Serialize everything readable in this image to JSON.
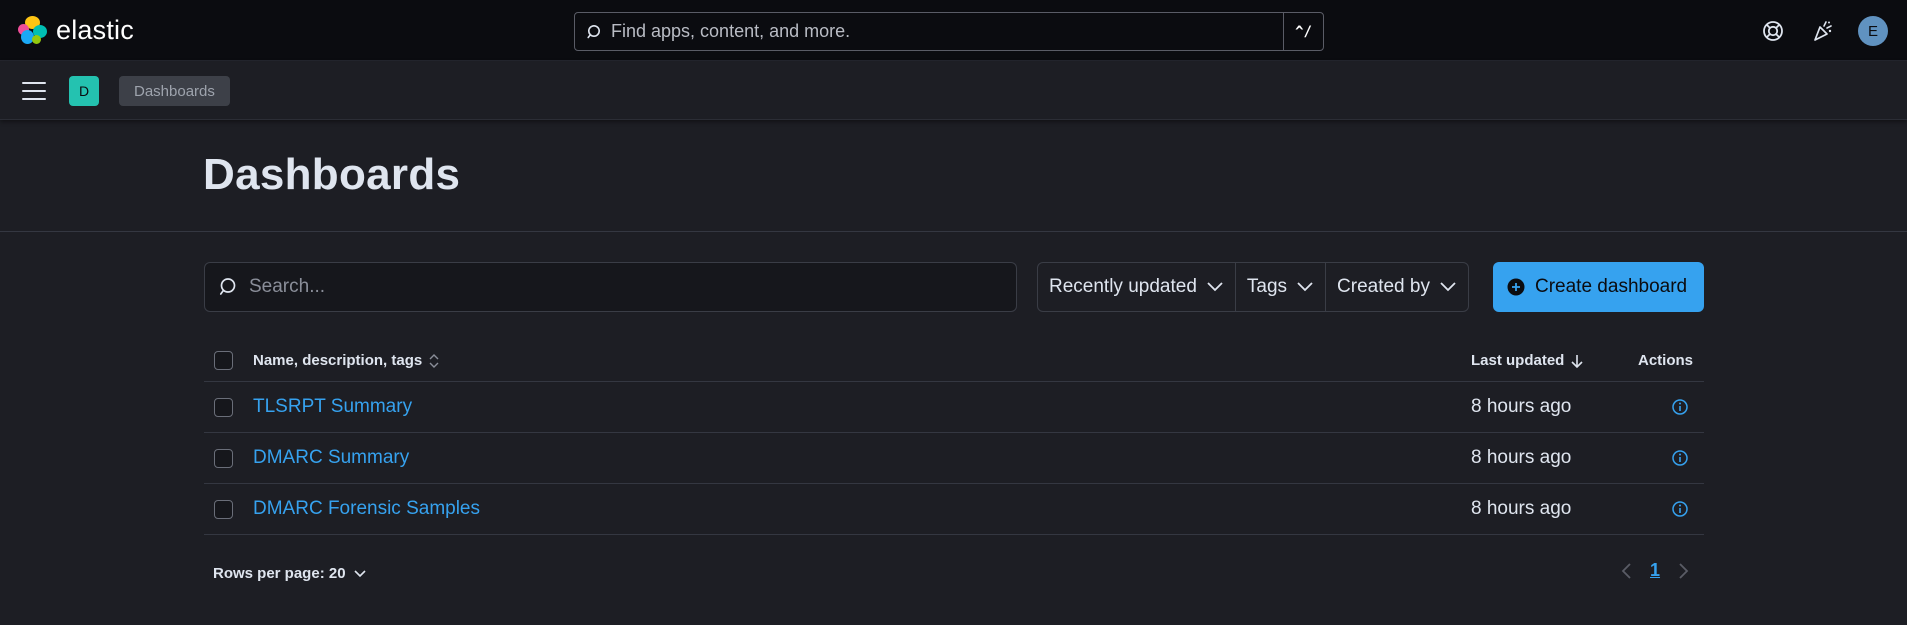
{
  "header": {
    "logo_text": "elastic",
    "search_placeholder": "Find apps, content, and more.",
    "shortcut": "^/",
    "avatar_initial": "E",
    "icons": [
      "help-icon",
      "news-feed-icon"
    ]
  },
  "subbar": {
    "space_initial": "D",
    "breadcrumb": "Dashboards"
  },
  "page": {
    "title": "Dashboards"
  },
  "toolbar": {
    "search_placeholder": "Search...",
    "filters": [
      "Recently updated",
      "Tags",
      "Created by"
    ],
    "create_label": "Create dashboard"
  },
  "table": {
    "columns": {
      "name": "Name, description, tags",
      "updated": "Last updated",
      "actions": "Actions"
    },
    "rows": [
      {
        "name": "TLSRPT Summary",
        "updated": "8 hours ago"
      },
      {
        "name": "DMARC Summary",
        "updated": "8 hours ago"
      },
      {
        "name": "DMARC Forensic Samples",
        "updated": "8 hours ago"
      }
    ]
  },
  "footer": {
    "rows_per_page": "Rows per page: 20",
    "current_page": "1"
  },
  "colors": {
    "accent": "#36a2ef",
    "header_bg": "#0b0c10",
    "body_bg": "#1d1e24",
    "space_badge": "#24c2b0",
    "avatar": "#6092c0"
  }
}
